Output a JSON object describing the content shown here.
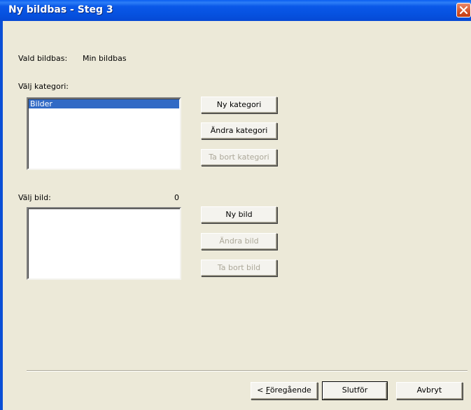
{
  "window": {
    "title": "Ny bildbas - Steg 3"
  },
  "database": {
    "label": "Vald bildbas:",
    "value": "Min bildbas"
  },
  "category": {
    "label": "Välj kategori:",
    "items": [
      "Bilder"
    ],
    "selected_index": 0,
    "buttons": {
      "new": "Ny kategori",
      "edit": "Ändra kategori",
      "delete": "Ta bort kategori"
    }
  },
  "image": {
    "label": "Välj bild:",
    "count": "0",
    "items": [],
    "buttons": {
      "new": "Ny bild",
      "edit": "Ändra bild",
      "delete": "Ta bort bild"
    }
  },
  "footer": {
    "previous_prefix": "< ",
    "previous_accel": "F",
    "previous_rest": "öregående",
    "finish": "Slutför",
    "cancel": "Avbryt"
  },
  "colors": {
    "titlebar": "#0a58e8",
    "selection": "#316ac5",
    "dialog_bg": "#ece9d8"
  },
  "icons": {
    "close": "close-icon"
  }
}
